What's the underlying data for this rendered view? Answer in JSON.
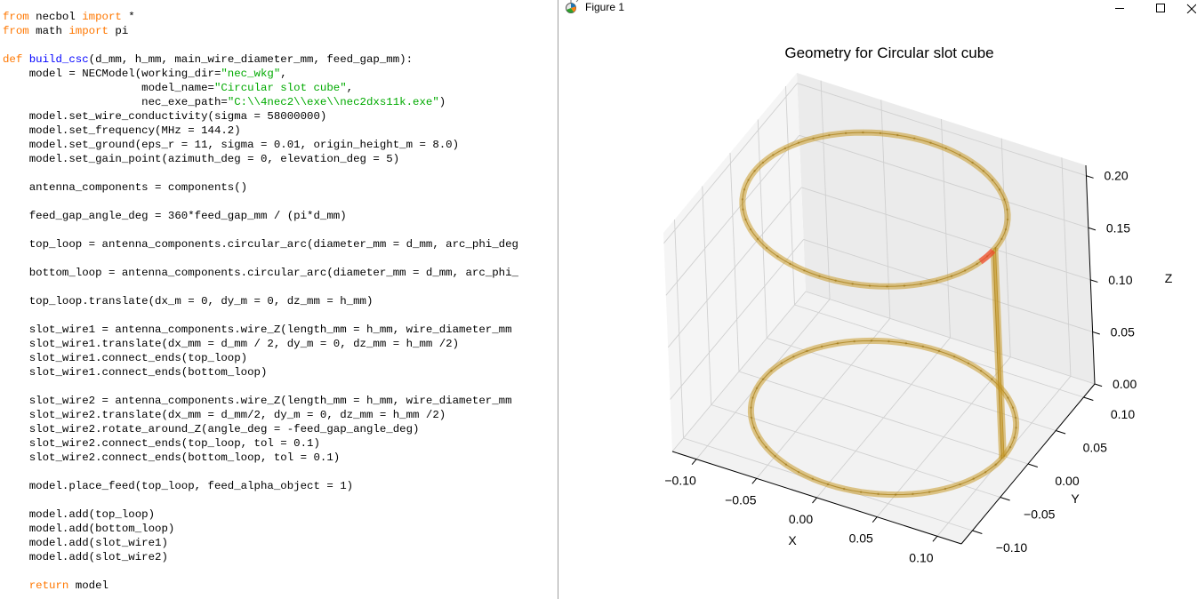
{
  "editor": {
    "lines": [
      [
        [
          "kw",
          "from"
        ],
        [
          "t",
          " necbol "
        ],
        [
          "kw",
          "import"
        ],
        [
          "t",
          " *"
        ]
      ],
      [
        [
          "kw",
          "from"
        ],
        [
          "t",
          " math "
        ],
        [
          "kw",
          "import"
        ],
        [
          "t",
          " pi"
        ]
      ],
      [],
      [
        [
          "kw",
          "def"
        ],
        [
          "t",
          " "
        ],
        [
          "fn",
          "build_csc"
        ],
        [
          "t",
          "(d_mm, h_mm, main_wire_diameter_mm, feed_gap_mm):"
        ]
      ],
      [
        [
          "t",
          "    model = NECModel(working_dir="
        ],
        [
          "str",
          "\"nec_wkg\""
        ],
        [
          "t",
          ","
        ]
      ],
      [
        [
          "t",
          "                     model_name="
        ],
        [
          "str",
          "\"Circular slot cube\""
        ],
        [
          "t",
          ","
        ]
      ],
      [
        [
          "t",
          "                     nec_exe_path="
        ],
        [
          "str",
          "\"C:\\\\4nec2\\\\exe\\\\nec2dxs11k.exe\""
        ],
        [
          "t",
          ")"
        ]
      ],
      [
        [
          "t",
          "    model.set_wire_conductivity(sigma = 58000000)"
        ]
      ],
      [
        [
          "t",
          "    model.set_frequency(MHz = 144.2)"
        ]
      ],
      [
        [
          "t",
          "    model.set_ground(eps_r = 11, sigma = 0.01, origin_height_m = 8.0)"
        ]
      ],
      [
        [
          "t",
          "    model.set_gain_point(azimuth_deg = 0, elevation_deg = 5)"
        ]
      ],
      [],
      [
        [
          "t",
          "    antenna_components = components()"
        ]
      ],
      [],
      [
        [
          "t",
          "    feed_gap_angle_deg = 360*feed_gap_mm / (pi*d_mm)"
        ]
      ],
      [],
      [
        [
          "t",
          "    top_loop = antenna_components.circular_arc(diameter_mm = d_mm, arc_phi_deg"
        ]
      ],
      [],
      [
        [
          "t",
          "    bottom_loop = antenna_components.circular_arc(diameter_mm = d_mm, arc_phi_"
        ]
      ],
      [],
      [
        [
          "t",
          "    top_loop.translate(dx_m = 0, dy_m = 0, dz_mm = h_mm)"
        ]
      ],
      [],
      [
        [
          "t",
          "    slot_wire1 = antenna_components.wire_Z(length_mm = h_mm, wire_diameter_mm "
        ]
      ],
      [
        [
          "t",
          "    slot_wire1.translate(dx_mm = d_mm / 2, dy_m = 0, dz_mm = h_mm /2)"
        ]
      ],
      [
        [
          "t",
          "    slot_wire1.connect_ends(top_loop)"
        ]
      ],
      [
        [
          "t",
          "    slot_wire1.connect_ends(bottom_loop)"
        ]
      ],
      [],
      [
        [
          "t",
          "    slot_wire2 = antenna_components.wire_Z(length_mm = h_mm, wire_diameter_mm "
        ]
      ],
      [
        [
          "t",
          "    slot_wire2.translate(dx_mm = d_mm/2, dy_m = 0, dz_mm = h_mm /2)"
        ]
      ],
      [
        [
          "t",
          "    slot_wire2.rotate_around_Z(angle_deg = -feed_gap_angle_deg)"
        ]
      ],
      [
        [
          "t",
          "    slot_wire2.connect_ends(top_loop, tol = 0.1)"
        ]
      ],
      [
        [
          "t",
          "    slot_wire2.connect_ends(bottom_loop, tol = 0.1)"
        ]
      ],
      [],
      [
        [
          "t",
          "    model.place_feed(top_loop, feed_alpha_object = 1)"
        ]
      ],
      [],
      [
        [
          "t",
          "    model.add(top_loop)"
        ]
      ],
      [
        [
          "t",
          "    model.add(bottom_loop)"
        ]
      ],
      [
        [
          "t",
          "    model.add(slot_wire1)"
        ]
      ],
      [
        [
          "t",
          "    model.add(slot_wire2)"
        ]
      ],
      [],
      [
        [
          "t",
          "    "
        ],
        [
          "kw",
          "return"
        ],
        [
          "t",
          " model"
        ]
      ]
    ]
  },
  "figure_window": {
    "title": "Figure 1",
    "app_icon": "matplotlib-icon",
    "controls": {
      "minimize": "minimize-icon",
      "maximize": "maximize-icon",
      "close": "close-icon"
    }
  },
  "colors": {
    "keyword": "#ff7700",
    "function_name": "#0000ff",
    "string": "#00aa00",
    "wire": "#d4a017",
    "feed": "#ff3030",
    "pane_gray": "#f2f2f2",
    "grid": "#d0d0d0"
  },
  "chart_data": {
    "type": "3d-line",
    "title": "Geometry for Circular slot cube",
    "xlabel": "X",
    "ylabel": "Y",
    "zlabel": "Z",
    "xlim": [
      -0.12,
      0.12
    ],
    "ylim": [
      -0.12,
      0.12
    ],
    "zlim": [
      0,
      0.21
    ],
    "x_ticks": [
      "−0.10",
      "−0.05",
      "0.00",
      "0.05",
      "0.10"
    ],
    "y_ticks": [
      "−0.10",
      "−0.05",
      "0.00",
      "0.05",
      "0.10"
    ],
    "z_ticks": [
      "0.00",
      "0.05",
      "0.10",
      "0.15",
      "0.20"
    ],
    "grid": true,
    "geometry": {
      "loop_diameter": 0.2,
      "height": 0.2,
      "top_loop": {
        "radius": 0.1,
        "z": 0.2
      },
      "bottom_loop": {
        "radius": 0.1,
        "z": 0.0
      },
      "slot_wires": [
        {
          "x": 0.1,
          "y": 0.0,
          "z": [
            0,
            0.2
          ]
        },
        {
          "x": 0.0999,
          "y": -0.004,
          "z": [
            0,
            0.2
          ]
        }
      ],
      "feed": {
        "on": "top_loop",
        "position": "near slot"
      }
    }
  }
}
